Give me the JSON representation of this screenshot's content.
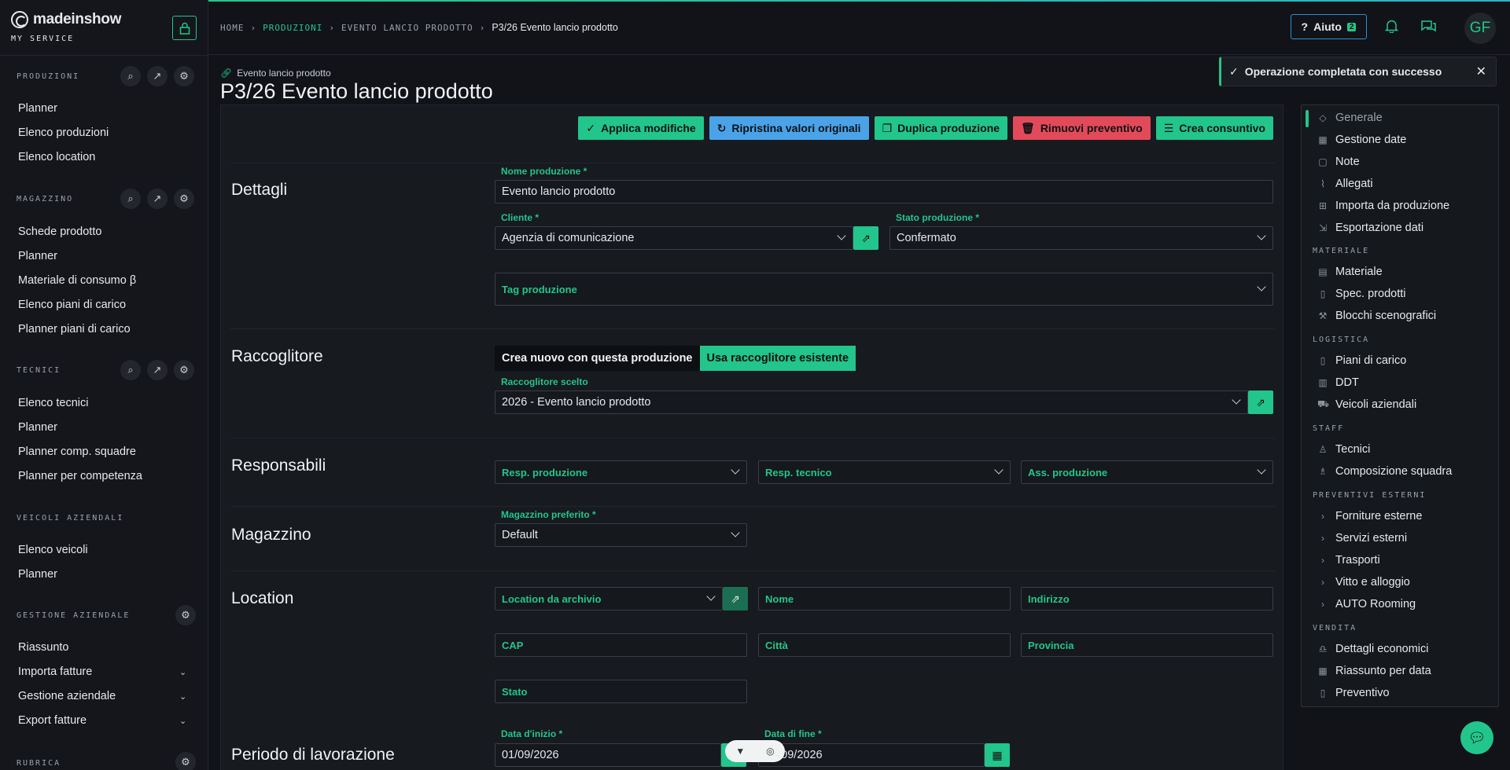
{
  "brand": {
    "name": "madeinshow",
    "subtitle": "MY SERVICE"
  },
  "sidebar": {
    "sections": [
      {
        "title": "PRODUZIONI",
        "items": [
          "Planner",
          "Elenco produzioni",
          "Elenco location"
        ]
      },
      {
        "title": "MAGAZZINO",
        "items": [
          "Schede prodotto",
          "Planner",
          "Materiale di consumo β",
          "Elenco piani di carico",
          "Planner piani di carico"
        ]
      },
      {
        "title": "TECNICI",
        "items": [
          "Elenco tecnici",
          "Planner",
          "Planner comp. squadre",
          "Planner per competenza"
        ]
      },
      {
        "title": "VEICOLI AZIENDALI",
        "items": [
          "Elenco veicoli",
          "Planner"
        ]
      },
      {
        "title": "GESTIONE AZIENDALE",
        "items": [
          "Riassunto",
          "Importa fatture",
          "Gestione aziendale",
          "Export fatture"
        ]
      },
      {
        "title": "RUBRICA",
        "items": []
      }
    ]
  },
  "header": {
    "breadcrumbs": [
      "HOME",
      "PRODUZIONI",
      "EVENTO LANCIO PRODOTTO",
      "P3/26 Evento lancio prodotto"
    ],
    "help_label": "Aiuto",
    "help_badge": "2",
    "avatar_initials": "GF"
  },
  "page": {
    "subtitle": "Evento lancio prodotto",
    "title": "P3/26 Evento lancio prodotto"
  },
  "toast": {
    "message": "Operazione completata con successo"
  },
  "actions": {
    "apply": "Applica modifiche",
    "reset": "Ripristina valori originali",
    "duplicate": "Duplica produzione",
    "remove_quote": "Rimuovi preventivo",
    "create_final": "Crea consuntivo"
  },
  "form": {
    "dettagli": {
      "section": "Dettagli",
      "nome_label": "Nome produzione *",
      "nome_value": "Evento lancio prodotto",
      "cliente_label": "Cliente *",
      "cliente_value": "Agenzia di comunicazione",
      "stato_label": "Stato produzione *",
      "stato_value": "Confermato",
      "tag_placeholder": "Tag produzione"
    },
    "raccoglitore": {
      "section": "Raccoglitore",
      "option_new": "Crea nuovo con questa produzione",
      "option_existing": "Usa raccoglitore esistente",
      "chosen_label": "Raccoglitore scelto",
      "chosen_value": "2026 - Evento lancio prodotto"
    },
    "responsabili": {
      "section": "Responsabili",
      "resp_prod": "Resp. produzione",
      "resp_tec": "Resp. tecnico",
      "ass_prod": "Ass. produzione"
    },
    "magazzino": {
      "section": "Magazzino",
      "label": "Magazzino preferito *",
      "value": "Default"
    },
    "location": {
      "section": "Location",
      "archivio": "Location da archivio",
      "nome": "Nome",
      "indirizzo": "Indirizzo",
      "cap": "CAP",
      "citta": "Città",
      "provincia": "Provincia",
      "stato": "Stato"
    },
    "periodo": {
      "section": "Periodo di lavorazione",
      "start_label": "Data d'inizio *",
      "start_value": "01/09/2026",
      "end_label": "Data di fine *",
      "end_value": "01/09/2026"
    }
  },
  "right_nav": {
    "items_top": [
      "Generale",
      "Gestione date",
      "Note",
      "Allegati",
      "Importa da produzione",
      "Esportazione dati"
    ],
    "materiale_head": "MATERIALE",
    "materiale": [
      "Materiale",
      "Spec. prodotti",
      "Blocchi scenografici"
    ],
    "logistica_head": "LOGISTICA",
    "logistica": [
      "Piani di carico",
      "DDT",
      "Veicoli aziendali"
    ],
    "staff_head": "STAFF",
    "staff": [
      "Tecnici",
      "Composizione squadra"
    ],
    "preventivi_head": "PREVENTIVI ESTERNI",
    "preventivi": [
      "Forniture esterne",
      "Servizi esterni",
      "Trasporti",
      "Vitto e alloggio",
      "AUTO Rooming"
    ],
    "vendita_head": "VENDITA",
    "vendita": [
      "Dettagli economici",
      "Riassunto per data",
      "Preventivo"
    ]
  },
  "colors": {
    "accent": "#22c58b",
    "blue": "#4aa3e8",
    "red": "#e24a5a",
    "background": "#111318"
  }
}
